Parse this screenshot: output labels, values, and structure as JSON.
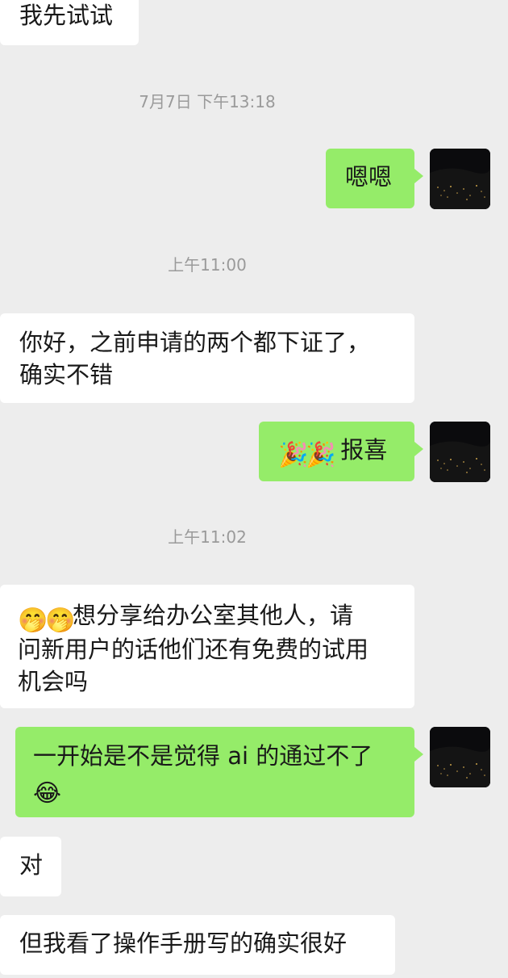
{
  "messages": {
    "m1": {
      "text": "我先试试"
    },
    "t1": {
      "text": "7月7日 下午13:18"
    },
    "m2": {
      "text": "嗯嗯"
    },
    "t2": {
      "text": "上午11:00"
    },
    "m3": {
      "line1": "你好，之前申请的两个都下证了，",
      "line2": "确实不错"
    },
    "m4": {
      "emoji1": "🎉",
      "emoji2": "🎉",
      "text": "报喜"
    },
    "t3": {
      "text": "上午11:02"
    },
    "m5": {
      "emoji1": "🤭",
      "emoji2": "🤭",
      "line1": "想分享给办公室其他人，请",
      "line2": "问新用户的话他们还有免费的试用",
      "line3": "机会吗"
    },
    "m6": {
      "line1": "一开始是不是觉得 ai 的通过不了",
      "emoji": "😂"
    },
    "m7": {
      "text": "对"
    },
    "m8": {
      "text": "但我看了操作手册写的确实很好"
    }
  },
  "colors": {
    "background": "#ededed",
    "incoming_bubble": "#ffffff",
    "outgoing_bubble": "#95ec69",
    "timestamp": "#9a9a9a",
    "avatar": "#0b0b0d"
  },
  "icons": {
    "avatar": "night-city-avatar",
    "party": "party-popper-emoji",
    "shy": "face-with-hand-over-mouth-emoji",
    "laugh": "face-with-tears-of-joy-emoji"
  }
}
